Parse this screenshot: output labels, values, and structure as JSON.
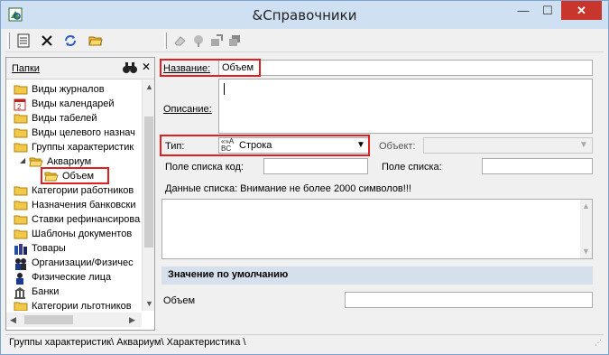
{
  "window": {
    "title": "&Справочники",
    "min_label": "—",
    "max_label": "☐",
    "close_label": "✕"
  },
  "toolbar": {
    "icons": [
      "document-icon",
      "delete-icon",
      "refresh-icon",
      "open-folder-icon",
      "eraser-icon",
      "paint-icon",
      "settings-icon",
      "window-icon"
    ]
  },
  "sidebar": {
    "title": "Папки",
    "close_label": "✕",
    "items": [
      {
        "label": "Виды журналов",
        "icon": "folder",
        "level": 0
      },
      {
        "label": "Виды календарей",
        "icon": "calendar",
        "level": 0
      },
      {
        "label": "Виды табелей",
        "icon": "folder",
        "level": 0
      },
      {
        "label": "Виды целевого назнач",
        "icon": "folder",
        "level": 0
      },
      {
        "label": "Группы характеристик",
        "icon": "folder",
        "level": 0
      },
      {
        "label": "Аквариум",
        "icon": "folder-open",
        "level": 1
      },
      {
        "label": "Объем",
        "icon": "folder-open",
        "level": 2
      },
      {
        "label": "Категории работников",
        "icon": "folder",
        "level": 0
      },
      {
        "label": "Назначения банковски",
        "icon": "folder",
        "level": 0
      },
      {
        "label": "Ставки рефинансирова",
        "icon": "folder",
        "level": 0
      },
      {
        "label": "Шаблоны документов",
        "icon": "folder",
        "level": 0
      },
      {
        "label": "Товары",
        "icon": "books",
        "level": 0
      },
      {
        "label": "Организации/Физичес",
        "icon": "people",
        "level": 0
      },
      {
        "label": "Физические лица",
        "icon": "person",
        "level": 0
      },
      {
        "label": "Банки",
        "icon": "bank",
        "level": 0
      },
      {
        "label": "Категории льготников",
        "icon": "folder",
        "level": 0
      }
    ]
  },
  "form": {
    "name_label": "Название:",
    "name_value": "Объем",
    "description_label": "Описание:",
    "description_value": "",
    "type_label": "Тип:",
    "type_value": "Строка",
    "type_icon_text": "«»ABC",
    "object_label": "Объект:",
    "object_value": "",
    "list_code_label": "Поле списка код:",
    "list_code_value": "",
    "list_field_label": "Поле списка:",
    "list_field_value": "",
    "list_data_label": "Данные списка: Внимание не более 2000 символов!!!",
    "list_data_value": "",
    "default_section": "Значение по умолчанию",
    "default_label": "Объем",
    "default_value": ""
  },
  "status": {
    "path": "Группы характеристик\\ Аквариум\\ Характеристика \\"
  },
  "colors": {
    "highlight": "#e02020",
    "section_bg": "#d6e0ec",
    "close_btn": "#c7352d"
  }
}
